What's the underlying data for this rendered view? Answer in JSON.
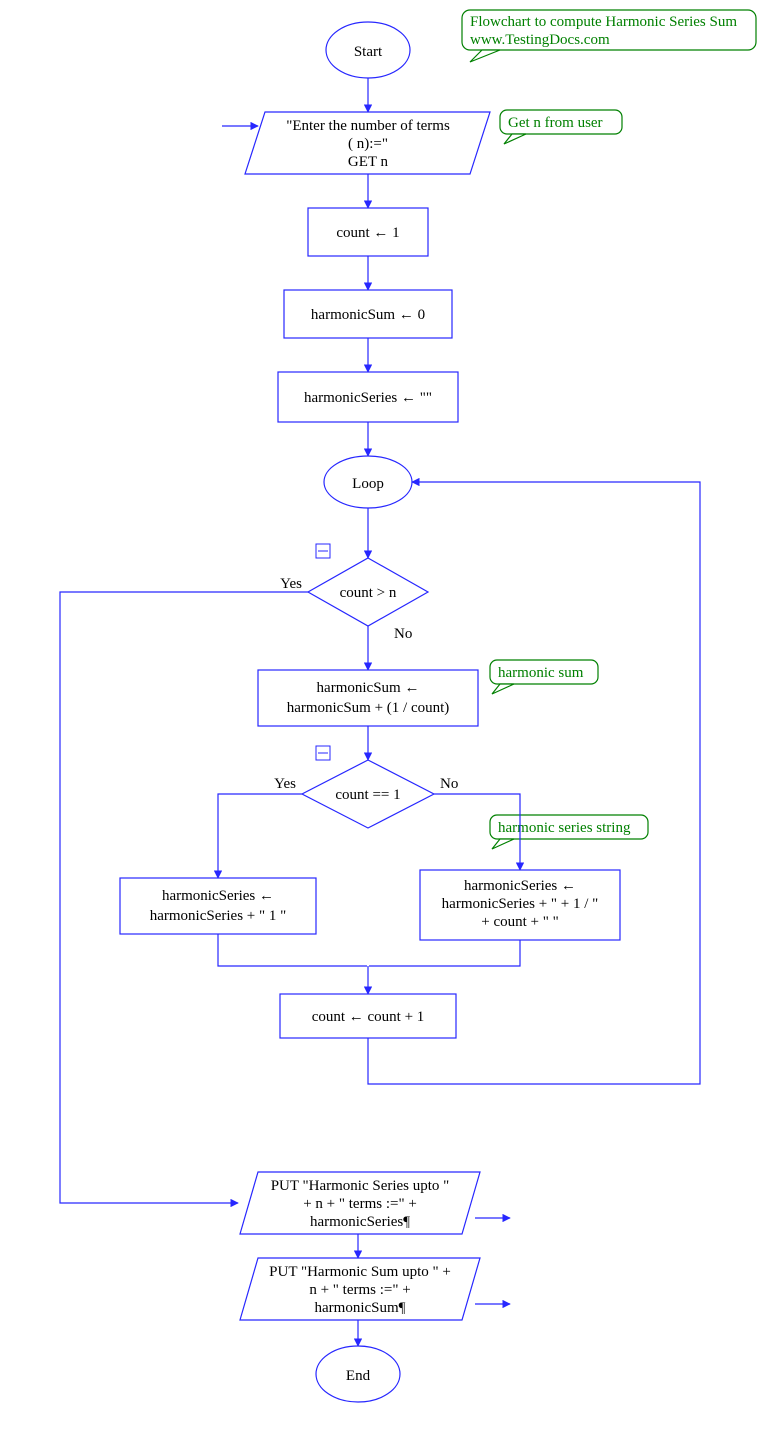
{
  "title_note": {
    "line1": "Flowchart to compute Harmonic Series Sum",
    "line2": "www.TestingDocs.com"
  },
  "start": "Start",
  "input_note": "Get n from user",
  "input": {
    "line1": "\"Enter the number of terms",
    "line2": "( n):=\"",
    "line3": "GET n"
  },
  "assign1": "count ← 1",
  "assign2": "harmonicSum ← 0",
  "assign3": "harmonicSeries ← \"\"",
  "loop": "Loop",
  "cond1": "count > n",
  "cond2": "count == 1",
  "yes": "Yes",
  "no": "No",
  "sum_note": "harmonic sum",
  "sum_assign": {
    "line1": "harmonicSum ←",
    "line2": "harmonicSum  +  (1 / count)"
  },
  "series_note": "harmonic series string",
  "left_assign": {
    "line1": "harmonicSeries ←",
    "line2": "harmonicSeries  +  \" 1 \""
  },
  "right_assign": {
    "line1": "harmonicSeries ←",
    "line2": "harmonicSeries  +  \"  +  1 / \"",
    "line3": "+   count  +  \"  \""
  },
  "incr": "count ← count  +  1",
  "output1": {
    "line1": "PUT \"Harmonic Series upto \"",
    "line2": "+ n + \" terms :=\" +",
    "line3": "harmonicSeries¶"
  },
  "output2": {
    "line1": "PUT \"Harmonic Sum upto \" +",
    "line2": "n + \" terms :=\" +",
    "line3": "harmonicSum¶"
  },
  "end": "End"
}
